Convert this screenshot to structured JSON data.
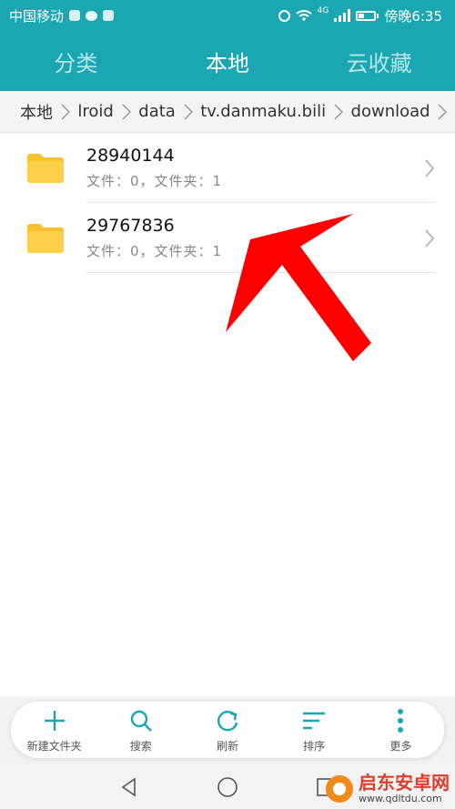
{
  "status": {
    "carrier": "中国移动",
    "network": "4G",
    "time": "傍晚6:35"
  },
  "tabs": [
    {
      "label": "分类",
      "active": false
    },
    {
      "label": "本地",
      "active": true
    },
    {
      "label": "云收藏",
      "active": false
    }
  ],
  "breadcrumb": [
    "本地",
    "lroid",
    "data",
    "tv.danmaku.bili",
    "download"
  ],
  "folders": [
    {
      "name": "28940144",
      "meta": "文件：0，文件夹：1"
    },
    {
      "name": "29767836",
      "meta": "文件：0，文件夹：1"
    }
  ],
  "toolbar": {
    "new_folder": "新建文件夹",
    "search": "搜索",
    "refresh": "刷新",
    "sort": "排序",
    "more": "更多"
  },
  "watermark": {
    "title": "启东安卓网",
    "url": "www.qdltdu.com"
  },
  "colors": {
    "accent": "#1aa7b2",
    "folder": "#fbc02d",
    "icon": "#1aa7b2",
    "arrow": "#ff0000"
  },
  "icons": [
    "wechat-icon",
    "alarm-icon",
    "wifi-icon",
    "signal-icon",
    "battery-icon",
    "folder-icon",
    "chevron-right-icon",
    "plus-icon",
    "search-icon",
    "refresh-icon",
    "sort-icon",
    "more-icon",
    "back-icon",
    "home-icon",
    "recents-icon"
  ]
}
